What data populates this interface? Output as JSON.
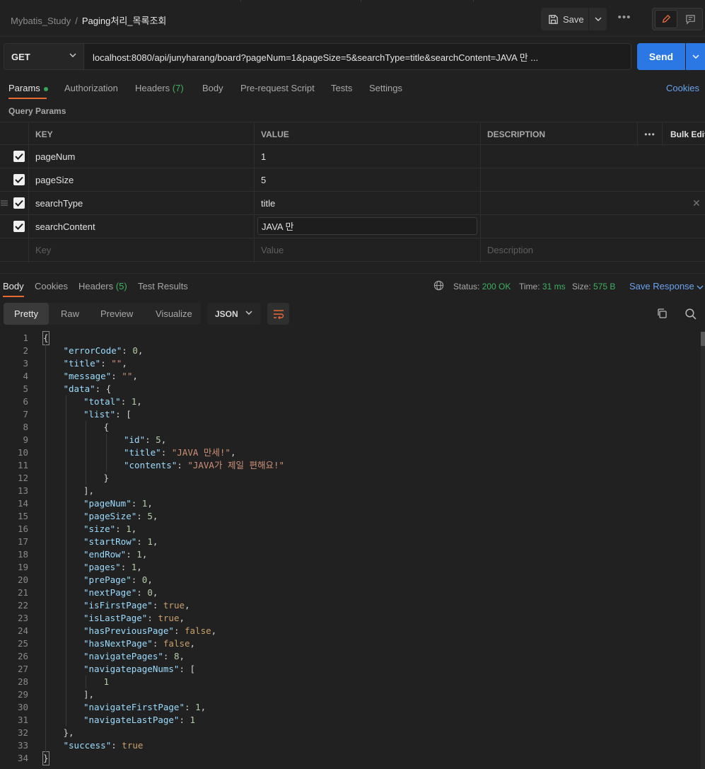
{
  "header": {
    "workspace": "Mybatis_Study",
    "separator": "/",
    "request_name": "Paging처리_목록조회",
    "save_label": "Save"
  },
  "request": {
    "method": "GET",
    "url": "localhost:8080/api/junyharang/board?pageNum=1&pageSize=5&searchType=title&searchContent=JAVA 만 ...",
    "send_label": "Send"
  },
  "req_tabs": {
    "params": "Params",
    "authorization": "Authorization",
    "headers": "Headers",
    "headers_count": "(7)",
    "body": "Body",
    "prerequest": "Pre-request Script",
    "tests": "Tests",
    "settings": "Settings",
    "cookies": "Cookies"
  },
  "query_params": {
    "title": "Query Params",
    "columns": {
      "key": "KEY",
      "value": "VALUE",
      "description": "DESCRIPTION",
      "bulk": "Bulk Edit"
    },
    "rows": [
      {
        "key": "pageNum",
        "value": "1"
      },
      {
        "key": "pageSize",
        "value": "5"
      },
      {
        "key": "searchType",
        "value": "title"
      },
      {
        "key": "searchContent",
        "value": "JAVA 만"
      }
    ],
    "placeholder": {
      "key": "Key",
      "value": "Value",
      "description": "Description"
    }
  },
  "response": {
    "tabs": {
      "body": "Body",
      "cookies": "Cookies",
      "headers": "Headers",
      "headers_count": "(5)",
      "tests": "Test Results"
    },
    "status_label": "Status:",
    "status_value": "200 OK",
    "time_label": "Time:",
    "time_value": "31 ms",
    "size_label": "Size:",
    "size_value": "575 B",
    "save_response": "Save Response",
    "formats": {
      "pretty": "Pretty",
      "raw": "Raw",
      "preview": "Preview",
      "visualize": "Visualize"
    },
    "language": "JSON"
  },
  "code_lines": [
    [
      [
        "p",
        "{"
      ]
    ],
    [
      [
        "k",
        "\"errorCode\""
      ],
      [
        "p",
        ": "
      ],
      [
        "n",
        "0"
      ],
      [
        "p",
        ","
      ]
    ],
    [
      [
        "k",
        "\"title\""
      ],
      [
        "p",
        ": "
      ],
      [
        "s",
        "\"\""
      ],
      [
        "p",
        ","
      ]
    ],
    [
      [
        "k",
        "\"message\""
      ],
      [
        "p",
        ": "
      ],
      [
        "s",
        "\"\""
      ],
      [
        "p",
        ","
      ]
    ],
    [
      [
        "k",
        "\"data\""
      ],
      [
        "p",
        ": {"
      ]
    ],
    [
      [
        "k",
        "\"total\""
      ],
      [
        "p",
        ": "
      ],
      [
        "n",
        "1"
      ],
      [
        "p",
        ","
      ]
    ],
    [
      [
        "k",
        "\"list\""
      ],
      [
        "p",
        ": ["
      ]
    ],
    [
      [
        "p",
        "{"
      ]
    ],
    [
      [
        "k",
        "\"id\""
      ],
      [
        "p",
        ": "
      ],
      [
        "n",
        "5"
      ],
      [
        "p",
        ","
      ]
    ],
    [
      [
        "k",
        "\"title\""
      ],
      [
        "p",
        ": "
      ],
      [
        "s",
        "\"JAVA 만세!\""
      ],
      [
        "p",
        ","
      ]
    ],
    [
      [
        "k",
        "\"contents\""
      ],
      [
        "p",
        ": "
      ],
      [
        "s",
        "\"JAVA가 제일 편해요!\""
      ]
    ],
    [
      [
        "p",
        "}"
      ]
    ],
    [
      [
        "p",
        "],"
      ]
    ],
    [
      [
        "k",
        "\"pageNum\""
      ],
      [
        "p",
        ": "
      ],
      [
        "n",
        "1"
      ],
      [
        "p",
        ","
      ]
    ],
    [
      [
        "k",
        "\"pageSize\""
      ],
      [
        "p",
        ": "
      ],
      [
        "n",
        "5"
      ],
      [
        "p",
        ","
      ]
    ],
    [
      [
        "k",
        "\"size\""
      ],
      [
        "p",
        ": "
      ],
      [
        "n",
        "1"
      ],
      [
        "p",
        ","
      ]
    ],
    [
      [
        "k",
        "\"startRow\""
      ],
      [
        "p",
        ": "
      ],
      [
        "n",
        "1"
      ],
      [
        "p",
        ","
      ]
    ],
    [
      [
        "k",
        "\"endRow\""
      ],
      [
        "p",
        ": "
      ],
      [
        "n",
        "1"
      ],
      [
        "p",
        ","
      ]
    ],
    [
      [
        "k",
        "\"pages\""
      ],
      [
        "p",
        ": "
      ],
      [
        "n",
        "1"
      ],
      [
        "p",
        ","
      ]
    ],
    [
      [
        "k",
        "\"prePage\""
      ],
      [
        "p",
        ": "
      ],
      [
        "n",
        "0"
      ],
      [
        "p",
        ","
      ]
    ],
    [
      [
        "k",
        "\"nextPage\""
      ],
      [
        "p",
        ": "
      ],
      [
        "n",
        "0"
      ],
      [
        "p",
        ","
      ]
    ],
    [
      [
        "k",
        "\"isFirstPage\""
      ],
      [
        "p",
        ": "
      ],
      [
        "b",
        "true"
      ],
      [
        "p",
        ","
      ]
    ],
    [
      [
        "k",
        "\"isLastPage\""
      ],
      [
        "p",
        ": "
      ],
      [
        "b",
        "true"
      ],
      [
        "p",
        ","
      ]
    ],
    [
      [
        "k",
        "\"hasPreviousPage\""
      ],
      [
        "p",
        ": "
      ],
      [
        "b",
        "false"
      ],
      [
        "p",
        ","
      ]
    ],
    [
      [
        "k",
        "\"hasNextPage\""
      ],
      [
        "p",
        ": "
      ],
      [
        "b",
        "false"
      ],
      [
        "p",
        ","
      ]
    ],
    [
      [
        "k",
        "\"navigatePages\""
      ],
      [
        "p",
        ": "
      ],
      [
        "n",
        "8"
      ],
      [
        "p",
        ","
      ]
    ],
    [
      [
        "k",
        "\"navigatepageNums\""
      ],
      [
        "p",
        ": ["
      ]
    ],
    [
      [
        "n",
        "1"
      ]
    ],
    [
      [
        "p",
        "],"
      ]
    ],
    [
      [
        "k",
        "\"navigateFirstPage\""
      ],
      [
        "p",
        ": "
      ],
      [
        "n",
        "1"
      ],
      [
        "p",
        ","
      ]
    ],
    [
      [
        "k",
        "\"navigateLastPage\""
      ],
      [
        "p",
        ": "
      ],
      [
        "n",
        "1"
      ]
    ],
    [
      [
        "p",
        "},"
      ]
    ],
    [
      [
        "k",
        "\"success\""
      ],
      [
        "p",
        ": "
      ],
      [
        "b",
        "true"
      ]
    ],
    [
      [
        "p",
        "}"
      ]
    ]
  ],
  "code_indent": [
    0,
    1,
    1,
    1,
    1,
    2,
    2,
    3,
    4,
    4,
    4,
    3,
    2,
    2,
    2,
    2,
    2,
    2,
    2,
    2,
    2,
    2,
    2,
    2,
    2,
    2,
    2,
    3,
    2,
    2,
    2,
    1,
    1,
    0
  ],
  "colors": {
    "accent_orange": "#e86a33",
    "send_blue": "#2b78e4",
    "status_green": "#3fb160",
    "link_blue": "#6aa3ee"
  }
}
